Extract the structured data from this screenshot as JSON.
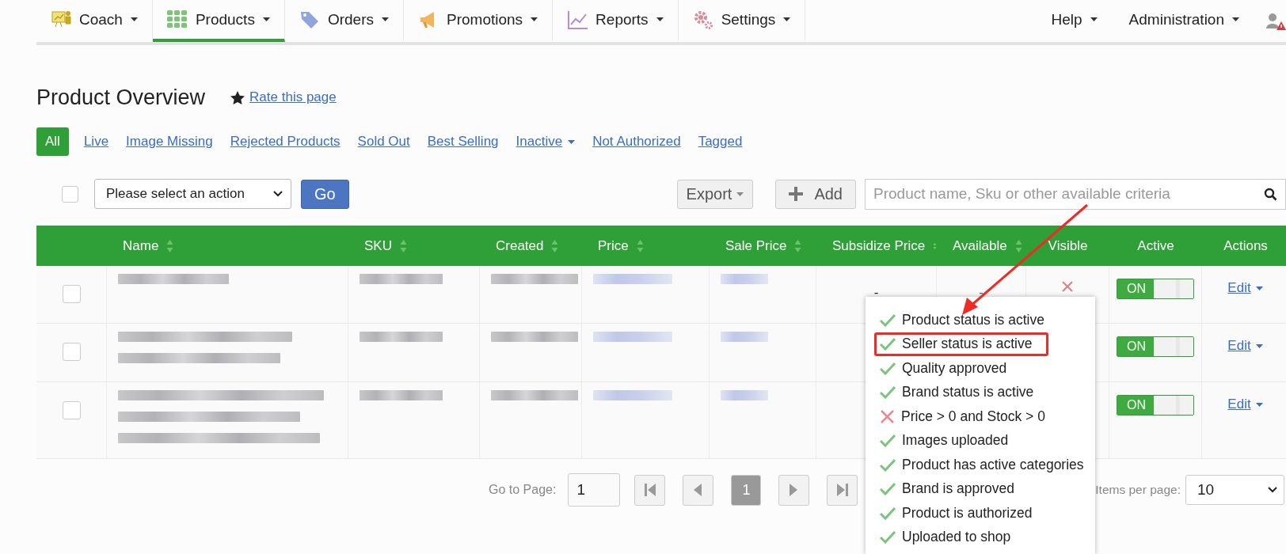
{
  "nav": {
    "items": [
      {
        "label": "Coach",
        "selected": false
      },
      {
        "label": "Products",
        "selected": true
      },
      {
        "label": "Orders",
        "selected": false
      },
      {
        "label": "Promotions",
        "selected": false
      },
      {
        "label": "Reports",
        "selected": false
      },
      {
        "label": "Settings",
        "selected": false
      }
    ],
    "right_items": [
      {
        "label": "Help"
      },
      {
        "label": "Administration"
      }
    ]
  },
  "page": {
    "title": "Product Overview",
    "rate_link": "Rate this page"
  },
  "filters": [
    {
      "label": "All",
      "selected": true,
      "has_menu": false
    },
    {
      "label": "Live",
      "selected": false,
      "has_menu": false
    },
    {
      "label": "Image Missing",
      "selected": false,
      "has_menu": false
    },
    {
      "label": "Rejected Products",
      "selected": false,
      "has_menu": false
    },
    {
      "label": "Sold Out",
      "selected": false,
      "has_menu": false
    },
    {
      "label": "Best Selling",
      "selected": false,
      "has_menu": false
    },
    {
      "label": "Inactive",
      "selected": false,
      "has_menu": true
    },
    {
      "label": "Not Authorized",
      "selected": false,
      "has_menu": false
    },
    {
      "label": "Tagged",
      "selected": false,
      "has_menu": false
    }
  ],
  "toolbar": {
    "select_all_checked": false,
    "action_select": "Please select an action",
    "go_button": "Go",
    "export_button": "Export",
    "add_button": "Add",
    "search": {
      "placeholder": "Product name, Sku or other available criteria"
    }
  },
  "table": {
    "columns": [
      {
        "label": "Name",
        "sortable": true
      },
      {
        "label": "SKU",
        "sortable": true
      },
      {
        "label": "Created",
        "sortable": true
      },
      {
        "label": "Price",
        "sortable": true
      },
      {
        "label": "Sale Price",
        "sortable": true
      },
      {
        "label": "Subsidize Price",
        "sortable": true
      },
      {
        "label": "Available",
        "sortable": true
      },
      {
        "label": "Visible",
        "sortable": false
      },
      {
        "label": "Active",
        "sortable": false
      },
      {
        "label": "Actions",
        "sortable": false
      }
    ],
    "rows": [
      {
        "checked": false,
        "subsidize_price": "-",
        "available": "-",
        "visible": "×",
        "active": {
          "label": "ON",
          "on": true
        },
        "action": "Edit"
      },
      {
        "checked": false,
        "active": {
          "label": "ON",
          "on": true
        },
        "action": "Edit"
      },
      {
        "checked": false,
        "active": {
          "label": "ON",
          "on": true
        },
        "action": "Edit"
      }
    ]
  },
  "status_popup": {
    "items": [
      {
        "label": "Product status is active",
        "passed": true,
        "highlighted": false
      },
      {
        "label": "Seller status is active",
        "passed": true,
        "highlighted": true
      },
      {
        "label": "Quality approved",
        "passed": true,
        "highlighted": false
      },
      {
        "label": "Brand status is active",
        "passed": true,
        "highlighted": false
      },
      {
        "label": "Price > 0 and Stock > 0",
        "passed": false,
        "highlighted": false
      },
      {
        "label": "Images uploaded",
        "passed": true,
        "highlighted": false
      },
      {
        "label": "Product has active categories",
        "passed": true,
        "highlighted": false
      },
      {
        "label": "Brand is approved",
        "passed": true,
        "highlighted": false
      },
      {
        "label": "Product is authorized",
        "passed": true,
        "highlighted": false
      },
      {
        "label": "Uploaded to shop",
        "passed": true,
        "highlighted": false
      }
    ]
  },
  "pagination": {
    "goto_label": "Go to Page:",
    "page_input": "1",
    "pages": [
      {
        "label": "1",
        "selected": true
      }
    ],
    "items_label": "Items per page:",
    "items_select": "10"
  }
}
